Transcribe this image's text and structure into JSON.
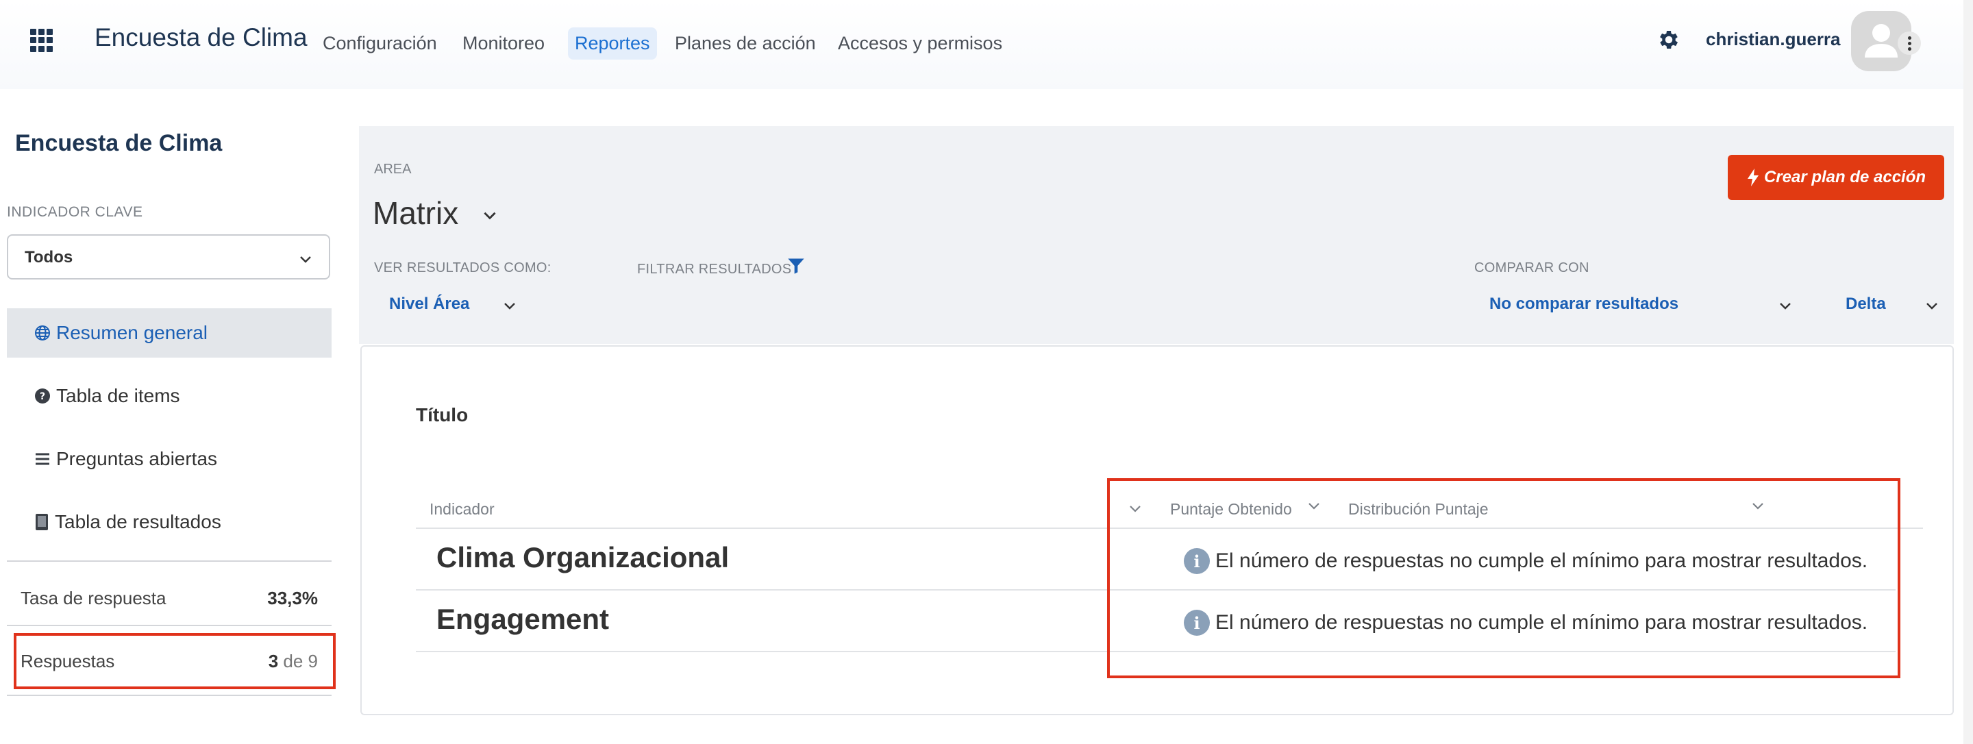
{
  "header": {
    "app_title": "Encuesta de Clima",
    "nav": [
      {
        "label": "Configuración",
        "active": false
      },
      {
        "label": "Monitoreo",
        "active": false
      },
      {
        "label": "Reportes",
        "active": true
      },
      {
        "label": "Planes de acción",
        "active": false
      },
      {
        "label": "Accesos y permisos",
        "active": false
      }
    ],
    "username": "christian.guerra",
    "icons": {
      "apps": "apps-grid-icon",
      "settings": "gear-icon",
      "avatar": "user-avatar-icon",
      "more": "kebab-menu-icon"
    }
  },
  "sidebar": {
    "title": "Encuesta de Clima",
    "indicator_label": "INDICADOR CLAVE",
    "indicator_value": "Todos",
    "items": [
      {
        "label": "Resumen general",
        "icon": "globe-icon",
        "active": true
      },
      {
        "label": "Tabla de items",
        "icon": "question-circle-icon",
        "active": false
      },
      {
        "label": "Preguntas abiertas",
        "icon": "list-icon",
        "active": false
      },
      {
        "label": "Tabla de resultados",
        "icon": "tablet-icon",
        "active": false
      }
    ],
    "stats": {
      "tasa_label": "Tasa de respuesta",
      "tasa_value": "33,3%",
      "respuestas_label": "Respuestas",
      "respuestas_count": "3",
      "respuestas_total": "de 9"
    }
  },
  "filters": {
    "area_label": "AREA",
    "area_value": "Matrix",
    "ver_label": "VER RESULTADOS COMO:",
    "ver_value": "Nivel Área",
    "filtrar_label": "FILTRAR RESULTADOS",
    "comparar_label": "COMPARAR CON",
    "comparar_value": "No comparar resultados",
    "delta_value": "Delta",
    "crear_button": "Crear plan de acción"
  },
  "card": {
    "title": "Título",
    "columns": [
      "Indicador",
      "Puntaje Obtenido",
      "Distribución Puntaje"
    ],
    "rows": [
      {
        "indicator": "Clima Organizacional",
        "message": "El número de respuestas no cumple el mínimo para mostrar resultados."
      },
      {
        "indicator": "Engagement",
        "message": "El número de respuestas no cumple el mínimo para mostrar resultados."
      }
    ]
  },
  "colors": {
    "accent": "#1b5fb4",
    "brand_dark": "#1e3552",
    "action": "#e13a12",
    "highlight": "#e0321b"
  }
}
